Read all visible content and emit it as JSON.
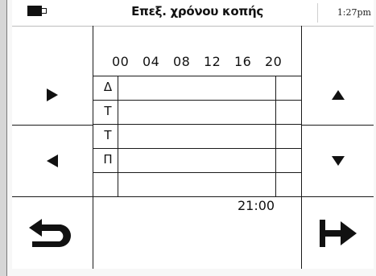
{
  "header": {
    "title": "Επεξ. χρόνου κοπής",
    "time": "1:27pm",
    "battery_icon": "battery-icon"
  },
  "schedule": {
    "hours": [
      "00",
      "04",
      "08",
      "12",
      "16",
      "20"
    ],
    "days": [
      "Δ",
      "Τ",
      "Τ",
      "Π",
      ""
    ],
    "selected_time": "21:00"
  },
  "buttons": {
    "left_top": "play-right-icon",
    "left_middle": "play-left-icon",
    "right_top": "arrow-up-icon",
    "right_middle": "arrow-down-icon",
    "back": "back-arrow-icon",
    "next": "forward-bar-arrow-icon"
  },
  "colors": {
    "foreground": "#111111",
    "background": "#ffffff",
    "chrome": "#d6d6d6"
  }
}
